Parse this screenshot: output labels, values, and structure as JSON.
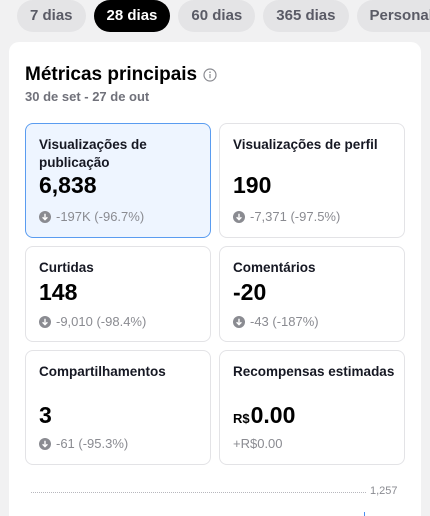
{
  "period_tabs": [
    {
      "label": "7 dias",
      "active": false
    },
    {
      "label": "28 dias",
      "active": true
    },
    {
      "label": "60 dias",
      "active": false
    },
    {
      "label": "365 dias",
      "active": false
    },
    {
      "label": "Personalizado",
      "active": false
    }
  ],
  "metrics": {
    "title": "Métricas principais",
    "info_icon": "info-circle-icon",
    "date_range": "30 de set - 27 de out",
    "tiles": [
      {
        "label": "Visualizações de publicação",
        "value": "6,838",
        "delta": "-197K (-96.7%)",
        "selected": true
      },
      {
        "label": "Visualizações de perfil",
        "value": "190",
        "delta": "-7,371 (-97.5%)",
        "selected": false
      },
      {
        "label": "Curtidas",
        "value": "148",
        "delta": "-9,010 (-98.4%)",
        "selected": false
      },
      {
        "label": "Comentários",
        "value": "-20",
        "delta": "-43 (-187%)",
        "selected": false
      },
      {
        "label": "Compartilhamentos",
        "value": "3",
        "delta": "-61 (-95.3%)",
        "selected": false
      },
      {
        "label": "Recompensas estimadas",
        "currency": "R$",
        "value": "0.00",
        "delta": "+R$0.00",
        "selected": false
      }
    ]
  },
  "chart": {
    "max_label": "1,257"
  },
  "colors": {
    "accent": "#5a9cf0",
    "selected_bg": "#eef5ff",
    "delta_gray": "#8a8b91"
  }
}
